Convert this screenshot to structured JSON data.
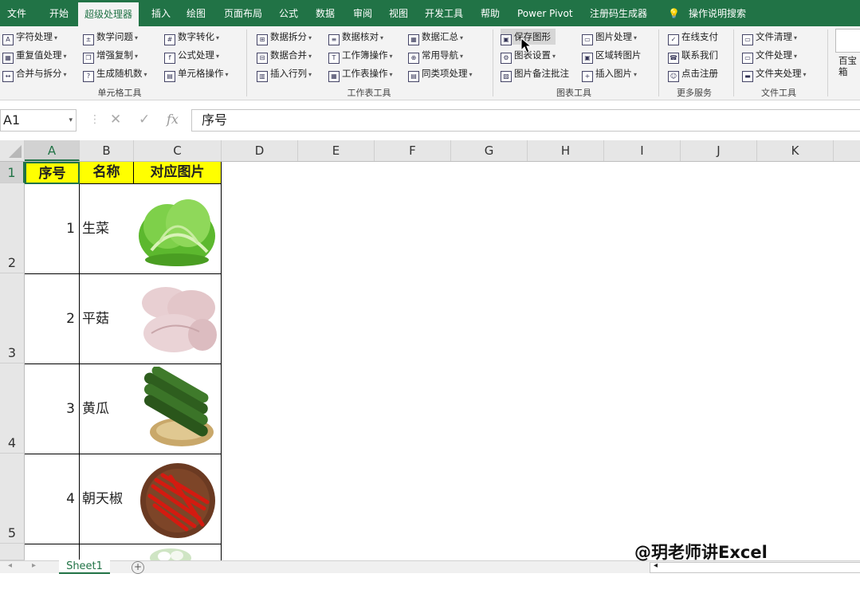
{
  "tabs": [
    {
      "label": "文件"
    },
    {
      "label": "开始"
    },
    {
      "label": "超级处理器"
    },
    {
      "label": "插入"
    },
    {
      "label": "绘图"
    },
    {
      "label": "页面布局"
    },
    {
      "label": "公式"
    },
    {
      "label": "数据"
    },
    {
      "label": "审阅"
    },
    {
      "label": "视图"
    },
    {
      "label": "开发工具"
    },
    {
      "label": "帮助"
    },
    {
      "label": "Power Pivot"
    },
    {
      "label": "注册码生成器"
    },
    {
      "label": "操作说明搜索"
    }
  ],
  "ribbon": {
    "g1": [
      "字符处理",
      "重复值处理",
      "合并与拆分"
    ],
    "g2": [
      "数学问题",
      "增强复制",
      "生成随机数"
    ],
    "g3": [
      "数字转化",
      "公式处理",
      "单元格操作"
    ],
    "g1_label": "单元格工具",
    "g4": [
      "数据拆分",
      "数据合并",
      "插入行列"
    ],
    "g5": [
      "数据核对",
      "工作簿操作",
      "工作表操作"
    ],
    "g6": [
      "数据汇总",
      "常用导航",
      "同类项处理"
    ],
    "g2_label": "工作表工具",
    "g7": [
      "保存图形",
      "图表设置",
      "图片备注批注"
    ],
    "g8": [
      "图片处理",
      "区域转图片",
      "插入图片"
    ],
    "g3_label": "图表工具",
    "g9": [
      "在线支付",
      "联系我们",
      "点击注册"
    ],
    "g4_label": "更多服务",
    "g10": [
      "文件清理",
      "文件处理",
      "文件夹处理"
    ],
    "g5_label": "文件工具",
    "extra": "百宝箱"
  },
  "formula": {
    "namebox": "A1",
    "fx": "fx",
    "value": "序号"
  },
  "columns": [
    "A",
    "B",
    "C",
    "D",
    "E",
    "F",
    "G",
    "H",
    "I",
    "J",
    "K"
  ],
  "rows": [
    "1",
    "2",
    "3",
    "4",
    "5"
  ],
  "header": {
    "a": "序号",
    "b": "名称",
    "c": "对应图片"
  },
  "items": [
    {
      "no": "1",
      "name": "生菜"
    },
    {
      "no": "2",
      "name": "平菇"
    },
    {
      "no": "3",
      "name": "黄瓜"
    },
    {
      "no": "4",
      "name": "朝天椒"
    }
  ],
  "sheet": {
    "name": "Sheet1"
  },
  "watermark": "@玥老师讲Excel",
  "colors": {
    "excel_green": "#217346",
    "header_yellow": "#ffff00"
  }
}
